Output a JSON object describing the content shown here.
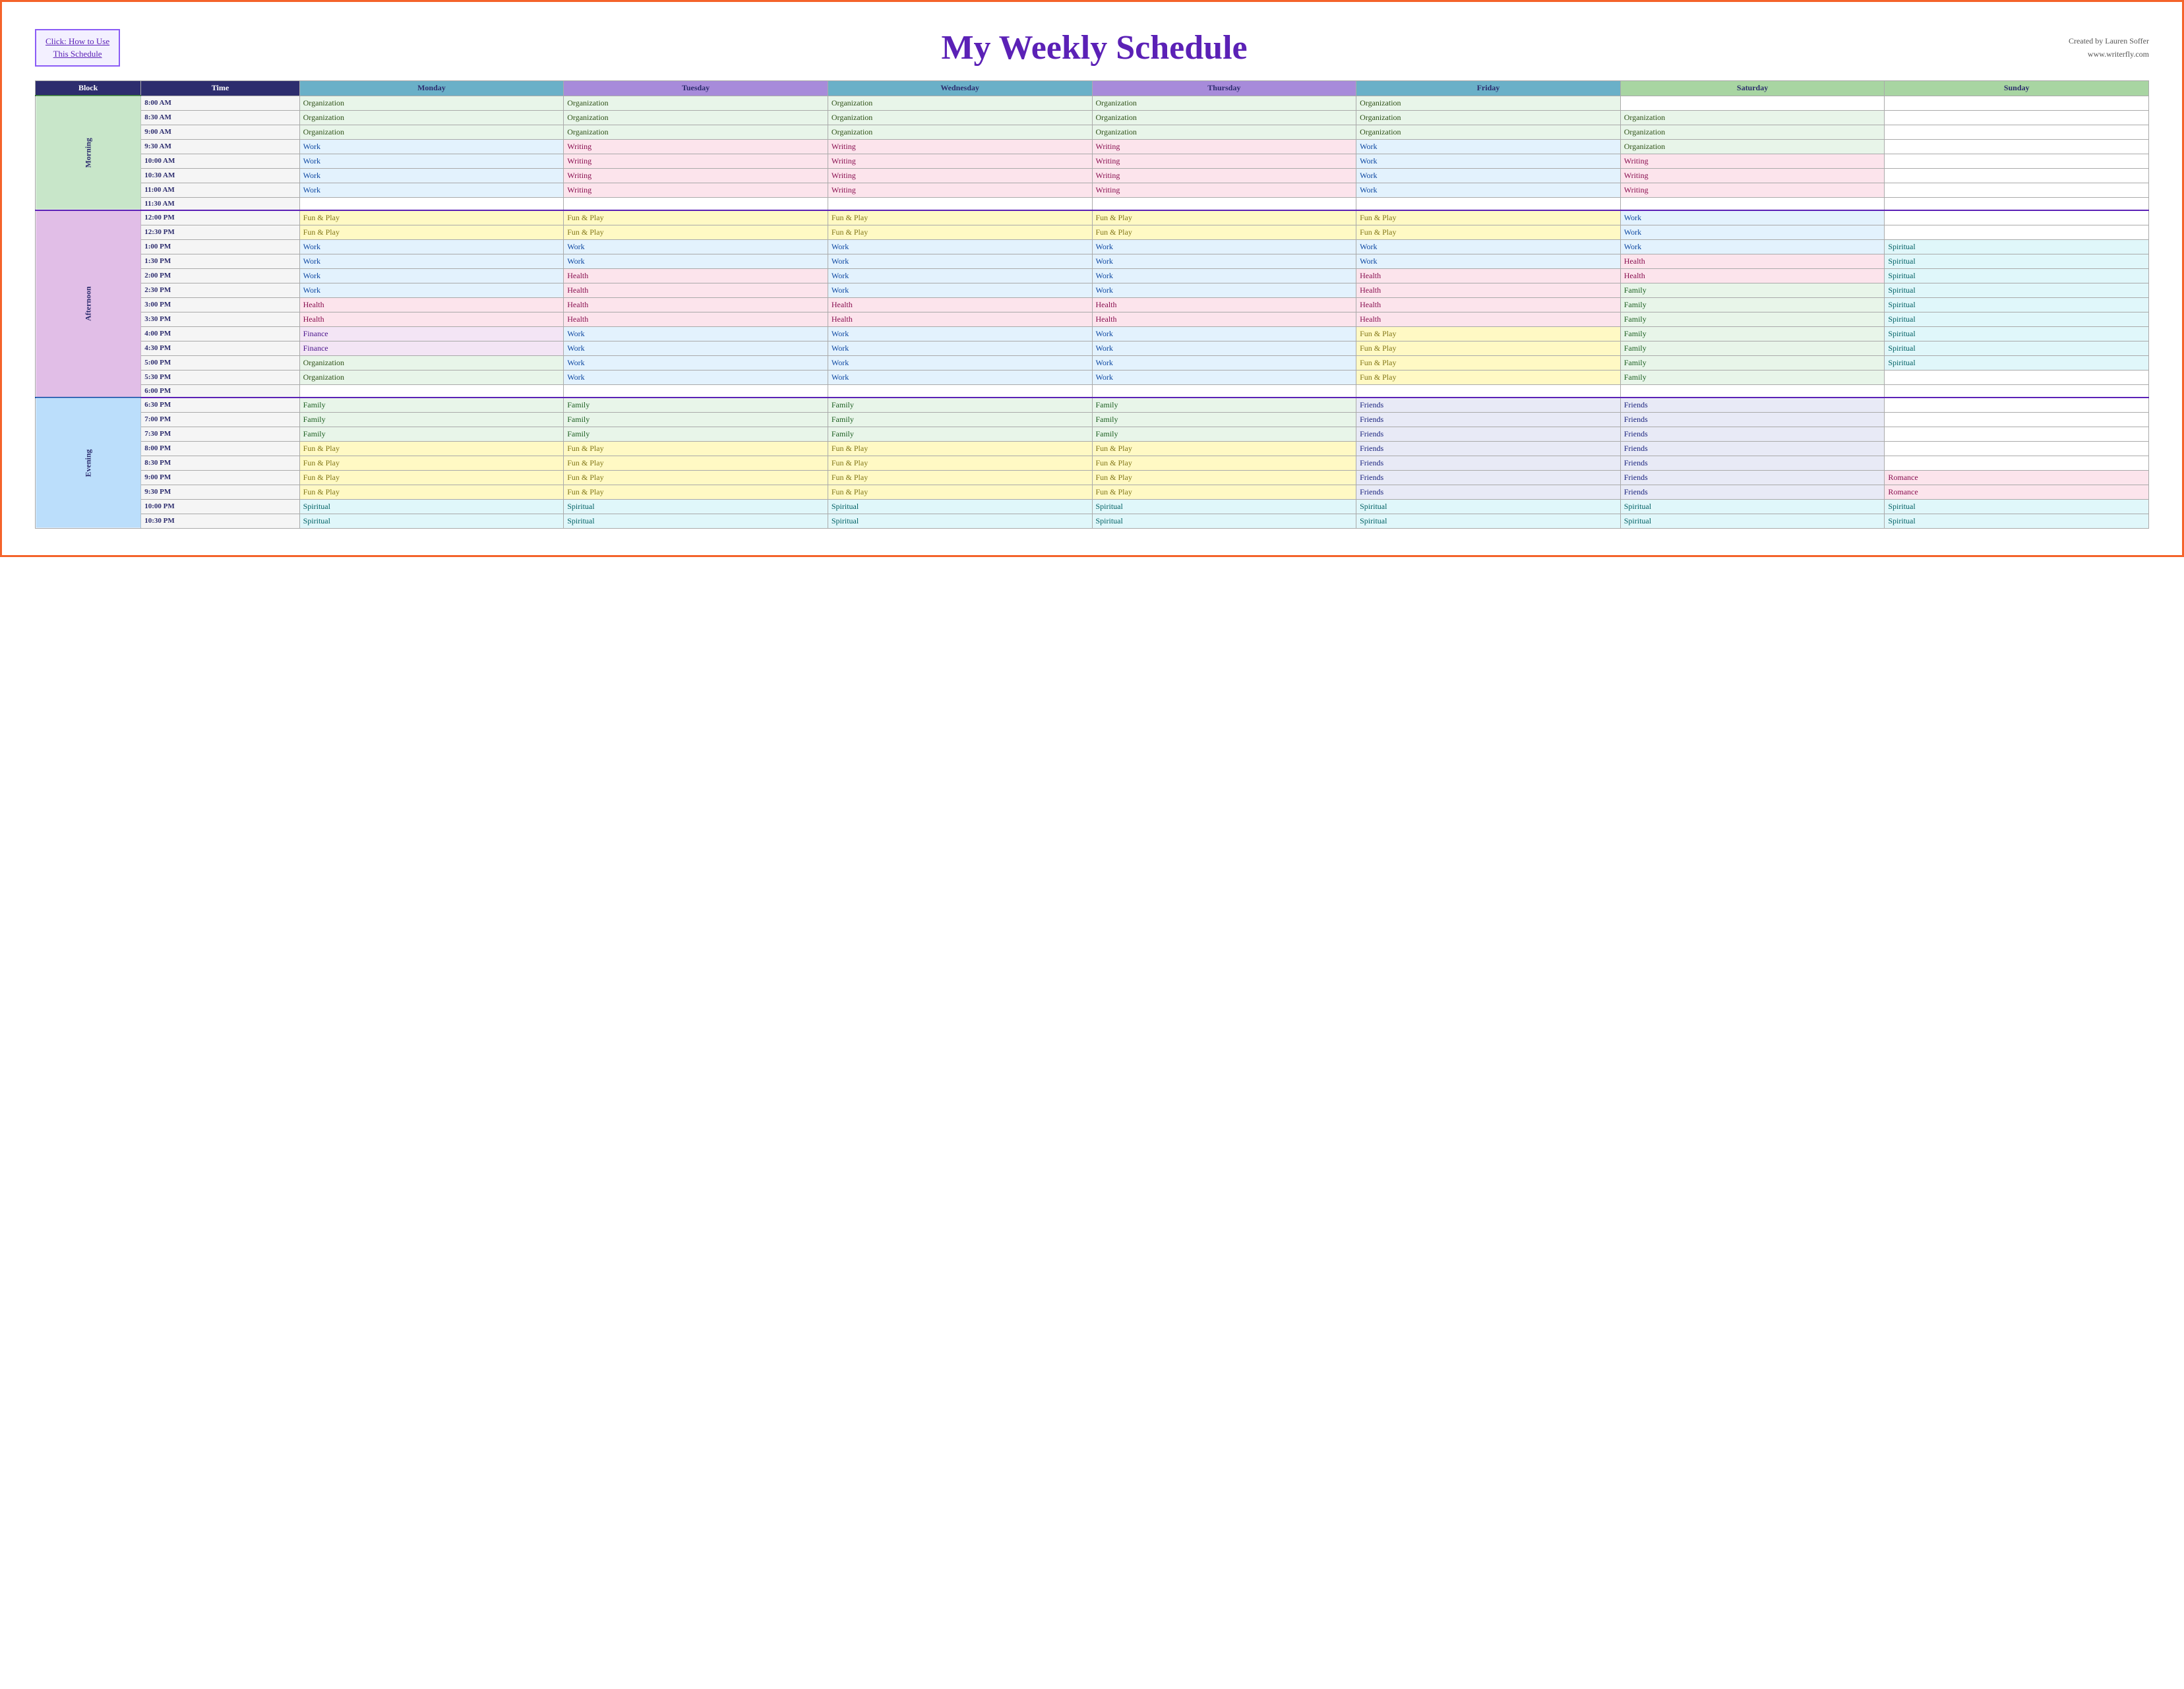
{
  "header": {
    "how_to_link_line1": "Click:  How to Use",
    "how_to_link_line2": "This Schedule",
    "title": "My Weekly Schedule",
    "credit_line1": "Created by Lauren Soffer",
    "credit_line2": "www.writerfly.com"
  },
  "table": {
    "columns": [
      "Block",
      "Time",
      "Monday",
      "Tuesday",
      "Wednesday",
      "Thursday",
      "Friday",
      "Saturday",
      "Sunday"
    ],
    "blocks": {
      "morning": "Morning",
      "afternoon": "Afternoon",
      "evening": "Evening"
    },
    "rows": [
      {
        "block": "Morning",
        "time": "8:00 AM",
        "monday": "Organization",
        "tuesday": "Organization",
        "wednesday": "Organization",
        "thursday": "Organization",
        "friday": "Organization",
        "saturday": "",
        "sunday": ""
      },
      {
        "block": "Morning",
        "time": "8:30 AM",
        "monday": "Organization",
        "tuesday": "Organization",
        "wednesday": "Organization",
        "thursday": "Organization",
        "friday": "Organization",
        "saturday": "Organization",
        "sunday": ""
      },
      {
        "block": "Morning",
        "time": "9:00 AM",
        "monday": "Organization",
        "tuesday": "Organization",
        "wednesday": "Organization",
        "thursday": "Organization",
        "friday": "Organization",
        "saturday": "Organization",
        "sunday": ""
      },
      {
        "block": "Morning",
        "time": "9:30 AM",
        "monday": "Work",
        "tuesday": "Writing",
        "wednesday": "Writing",
        "thursday": "Writing",
        "friday": "Work",
        "saturday": "Organization",
        "sunday": ""
      },
      {
        "block": "Morning",
        "time": "10:00 AM",
        "monday": "Work",
        "tuesday": "Writing",
        "wednesday": "Writing",
        "thursday": "Writing",
        "friday": "Work",
        "saturday": "Writing",
        "sunday": ""
      },
      {
        "block": "Morning",
        "time": "10:30 AM",
        "monday": "Work",
        "tuesday": "Writing",
        "wednesday": "Writing",
        "thursday": "Writing",
        "friday": "Work",
        "saturday": "Writing",
        "sunday": ""
      },
      {
        "block": "Morning",
        "time": "11:00 AM",
        "monday": "Work",
        "tuesday": "Writing",
        "wednesday": "Writing",
        "thursday": "Writing",
        "friday": "Work",
        "saturday": "Writing",
        "sunday": ""
      },
      {
        "block": "Morning",
        "time": "11:30 AM",
        "monday": "",
        "tuesday": "",
        "wednesday": "",
        "thursday": "",
        "friday": "",
        "saturday": "",
        "sunday": ""
      },
      {
        "block": "Afternoon",
        "time": "12:00 PM",
        "monday": "Fun & Play",
        "tuesday": "Fun & Play",
        "wednesday": "Fun & Play",
        "thursday": "Fun & Play",
        "friday": "Fun & Play",
        "saturday": "Work",
        "sunday": ""
      },
      {
        "block": "Afternoon",
        "time": "12:30 PM",
        "monday": "Fun & Play",
        "tuesday": "Fun & Play",
        "wednesday": "Fun & Play",
        "thursday": "Fun & Play",
        "friday": "Fun & Play",
        "saturday": "Work",
        "sunday": ""
      },
      {
        "block": "Afternoon",
        "time": "1:00 PM",
        "monday": "Work",
        "tuesday": "Work",
        "wednesday": "Work",
        "thursday": "Work",
        "friday": "Work",
        "saturday": "Work",
        "sunday": "Spiritual"
      },
      {
        "block": "Afternoon",
        "time": "1:30 PM",
        "monday": "Work",
        "tuesday": "Work",
        "wednesday": "Work",
        "thursday": "Work",
        "friday": "Work",
        "saturday": "Health",
        "sunday": "Spiritual"
      },
      {
        "block": "Afternoon",
        "time": "2:00 PM",
        "monday": "Work",
        "tuesday": "Health",
        "wednesday": "Work",
        "thursday": "Work",
        "friday": "Health",
        "saturday": "Health",
        "sunday": "Spiritual"
      },
      {
        "block": "Afternoon",
        "time": "2:30 PM",
        "monday": "Work",
        "tuesday": "Health",
        "wednesday": "Work",
        "thursday": "Work",
        "friday": "Health",
        "saturday": "Family",
        "sunday": "Spiritual"
      },
      {
        "block": "Afternoon",
        "time": "3:00 PM",
        "monday": "Health",
        "tuesday": "Health",
        "wednesday": "Health",
        "thursday": "Health",
        "friday": "Health",
        "saturday": "Family",
        "sunday": "Spiritual"
      },
      {
        "block": "Afternoon",
        "time": "3:30 PM",
        "monday": "Health",
        "tuesday": "Health",
        "wednesday": "Health",
        "thursday": "Health",
        "friday": "Health",
        "saturday": "Family",
        "sunday": "Spiritual"
      },
      {
        "block": "Afternoon",
        "time": "4:00 PM",
        "monday": "Finance",
        "tuesday": "Work",
        "wednesday": "Work",
        "thursday": "Work",
        "friday": "Fun & Play",
        "saturday": "Family",
        "sunday": "Spiritual"
      },
      {
        "block": "Afternoon",
        "time": "4:30 PM",
        "monday": "Finance",
        "tuesday": "Work",
        "wednesday": "Work",
        "thursday": "Work",
        "friday": "Fun & Play",
        "saturday": "Family",
        "sunday": "Spiritual"
      },
      {
        "block": "Afternoon",
        "time": "5:00 PM",
        "monday": "Organization",
        "tuesday": "Work",
        "wednesday": "Work",
        "thursday": "Work",
        "friday": "Fun & Play",
        "saturday": "Family",
        "sunday": "Spiritual"
      },
      {
        "block": "Afternoon",
        "time": "5:30 PM",
        "monday": "Organization",
        "tuesday": "Work",
        "wednesday": "Work",
        "thursday": "Work",
        "friday": "Fun & Play",
        "saturday": "Family",
        "sunday": ""
      },
      {
        "block": "Afternoon",
        "time": "6:00 PM",
        "monday": "",
        "tuesday": "",
        "wednesday": "",
        "thursday": "",
        "friday": "",
        "saturday": "",
        "sunday": ""
      },
      {
        "block": "Evening",
        "time": "6:30 PM",
        "monday": "Family",
        "tuesday": "Family",
        "wednesday": "Family",
        "thursday": "Family",
        "friday": "Friends",
        "saturday": "Friends",
        "sunday": ""
      },
      {
        "block": "Evening",
        "time": "7:00 PM",
        "monday": "Family",
        "tuesday": "Family",
        "wednesday": "Family",
        "thursday": "Family",
        "friday": "Friends",
        "saturday": "Friends",
        "sunday": ""
      },
      {
        "block": "Evening",
        "time": "7:30 PM",
        "monday": "Family",
        "tuesday": "Family",
        "wednesday": "Family",
        "thursday": "Family",
        "friday": "Friends",
        "saturday": "Friends",
        "sunday": ""
      },
      {
        "block": "Evening",
        "time": "8:00 PM",
        "monday": "Fun & Play",
        "tuesday": "Fun & Play",
        "wednesday": "Fun & Play",
        "thursday": "Fun & Play",
        "friday": "Friends",
        "saturday": "Friends",
        "sunday": ""
      },
      {
        "block": "Evening",
        "time": "8:30 PM",
        "monday": "Fun & Play",
        "tuesday": "Fun & Play",
        "wednesday": "Fun & Play",
        "thursday": "Fun & Play",
        "friday": "Friends",
        "saturday": "Friends",
        "sunday": ""
      },
      {
        "block": "Evening",
        "time": "9:00 PM",
        "monday": "Fun & Play",
        "tuesday": "Fun & Play",
        "wednesday": "Fun & Play",
        "thursday": "Fun & Play",
        "friday": "Friends",
        "saturday": "Friends",
        "sunday": "Romance"
      },
      {
        "block": "Evening",
        "time": "9:30 PM",
        "monday": "Fun & Play",
        "tuesday": "Fun & Play",
        "wednesday": "Fun & Play",
        "thursday": "Fun & Play",
        "friday": "Friends",
        "saturday": "Friends",
        "sunday": "Romance"
      },
      {
        "block": "Evening",
        "time": "10:00 PM",
        "monday": "Spiritual",
        "tuesday": "Spiritual",
        "wednesday": "Spiritual",
        "thursday": "Spiritual",
        "friday": "Spiritual",
        "saturday": "Spiritual",
        "sunday": "Spiritual"
      },
      {
        "block": "Evening",
        "time": "10:30 PM",
        "monday": "Spiritual",
        "tuesday": "Spiritual",
        "wednesday": "Spiritual",
        "thursday": "Spiritual",
        "friday": "Spiritual",
        "saturday": "Spiritual",
        "sunday": "Spiritual"
      }
    ]
  }
}
